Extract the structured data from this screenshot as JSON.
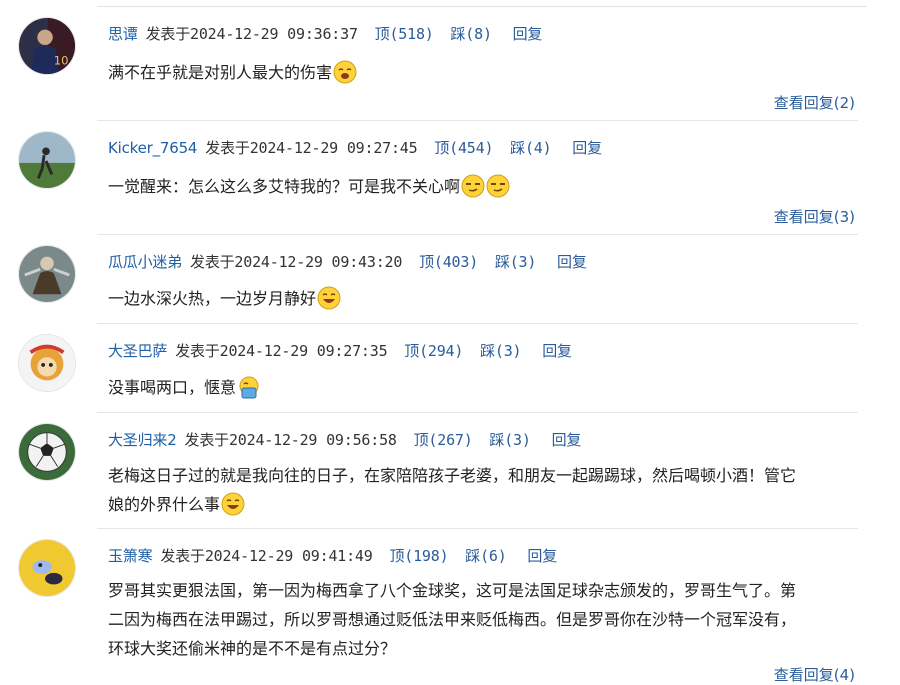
{
  "labels": {
    "posted_prefix": "发表于",
    "up": "顶",
    "down": "踩",
    "reply": "回复",
    "view_replies": "查看回复"
  },
  "comments": [
    {
      "user": "思谭",
      "time": "2024-12-29 09:36:37",
      "up_count": "(518)",
      "down_count": "(8)",
      "lines": [
        "满不在乎就是对别人最大的伤害"
      ],
      "emojis": [
        "sleepy-emoji"
      ],
      "reply_count": "(2)",
      "avatar": "footballer-avatar"
    },
    {
      "user": "Kicker_7654",
      "time": "2024-12-29 09:27:45",
      "up_count": "(454)",
      "down_count": "(4)",
      "lines": [
        "一觉醒来：怎么这么多艾特我的？可是我不关心啊"
      ],
      "emojis": [
        "smirk-emoji",
        "smirk-emoji"
      ],
      "reply_count": "(3)",
      "avatar": "kicker-avatar"
    },
    {
      "user": "瓜瓜小迷弟",
      "time": "2024-12-29 09:43:20",
      "up_count": "(403)",
      "down_count": "(3)",
      "lines": [
        "一边水深火热，一边岁月静好"
      ],
      "emojis": [
        "laugh-emoji"
      ],
      "reply_count": "",
      "avatar": "warrior-avatar"
    },
    {
      "user": "大圣巴萨",
      "time": "2024-12-29 09:27:35",
      "up_count": "(294)",
      "down_count": "(3)",
      "lines": [
        "没事喝两口，惬意"
      ],
      "emojis": [
        "drink-emoji"
      ],
      "reply_count": "",
      "avatar": "monkey-king-avatar"
    },
    {
      "user": "大圣归来2",
      "time": "2024-12-29 09:56:58",
      "up_count": "(267)",
      "down_count": "(3)",
      "lines": [
        "老梅这日子过的就是我向往的日子，在家陪陪孩子老婆，和朋友一起踢踢球，然后喝顿小酒！管它",
        "娘的外界什么事"
      ],
      "emojis": [
        "laugh-emoji"
      ],
      "reply_count": "",
      "avatar": "soccer-ball-avatar"
    },
    {
      "user": "玉箫寒",
      "time": "2024-12-29 09:41:49",
      "up_count": "(198)",
      "down_count": "(6)",
      "lines": [
        "罗哥其实更狠法国，第一因为梅西拿了八个金球奖，这可是法国足球杂志颁发的，罗哥生气了。第",
        "二因为梅西在法甲踢过，所以罗哥想通过贬低法甲来贬低梅西。但是罗哥你在沙特一个冠军没有，",
        "环球大奖还偷米神的是不不是有点过分？"
      ],
      "emojis": [],
      "reply_count": "(4)",
      "avatar": "duck-avatar"
    }
  ]
}
